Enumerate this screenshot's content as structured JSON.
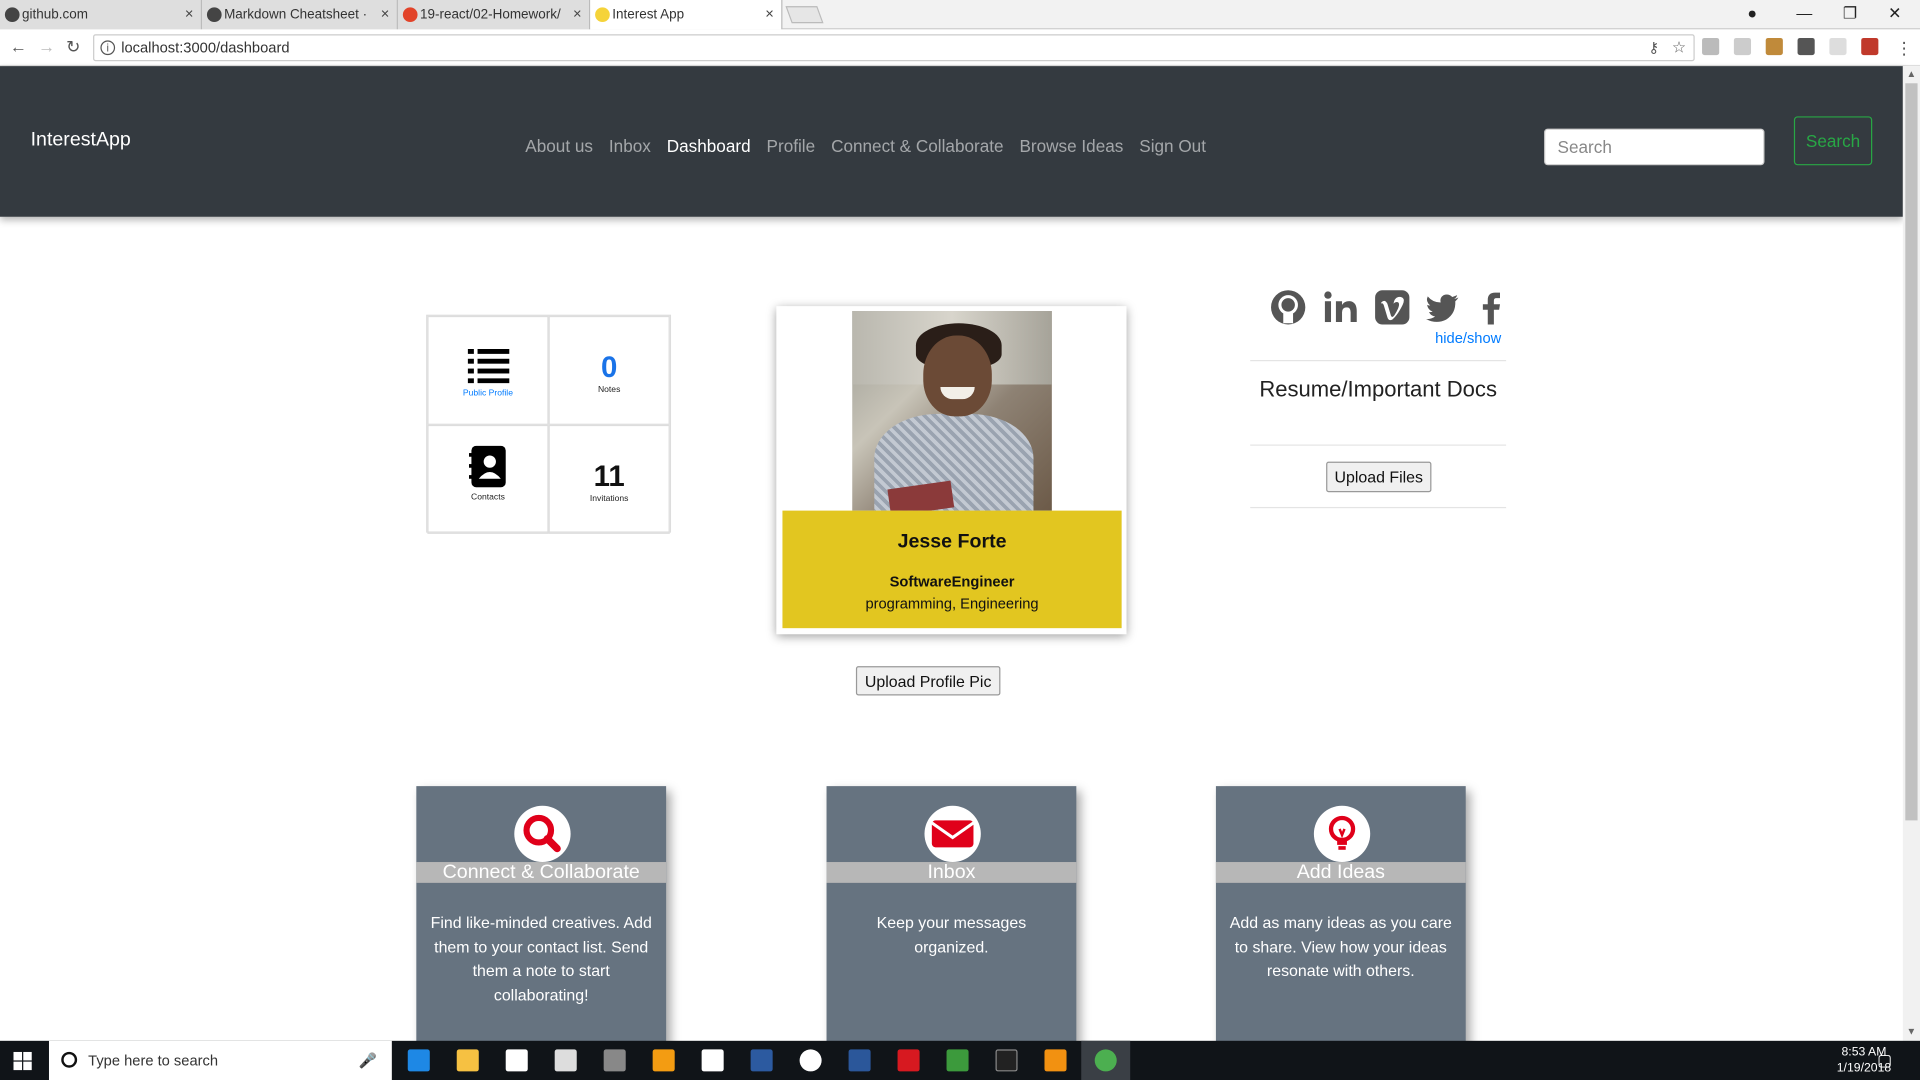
{
  "browser": {
    "tabs": [
      {
        "title": "github.com"
      },
      {
        "title": "Markdown Cheatsheet · "
      },
      {
        "title": "19-react/02-Homework/"
      },
      {
        "title": "Interest App"
      }
    ],
    "url": "localhost:3000/dashboard",
    "info_glyph": "i",
    "close_glyph": "×"
  },
  "navbar": {
    "brand": "InterestApp",
    "links": [
      "About us",
      "Inbox",
      "Dashboard",
      "Profile",
      "Connect & Collaborate",
      "Browse Ideas",
      "Sign Out"
    ],
    "active_link": "Dashboard",
    "search_placeholder": "Search",
    "search_button": "Search",
    "bg_color": "#343a40",
    "search_button_color": "#28a745"
  },
  "stats": {
    "public_profile_label": "Public Profile",
    "notes_count": "0",
    "notes_label": "Notes",
    "contacts_label": "Contacts",
    "invitations_count": "11",
    "invitations_label": "Invitations"
  },
  "profile": {
    "name": "Jesse Forte",
    "title": "SoftwareEngineer",
    "interests": "programming, Engineering",
    "upload_button": "Upload Profile Pic",
    "accent_color": "#e2c620"
  },
  "sidebar": {
    "social_icons": [
      "github-icon",
      "linkedin-icon",
      "vimeo-icon",
      "twitter-icon",
      "facebook-icon"
    ],
    "hide_show": "hide/show",
    "resume_heading": "Resume/Important Docs",
    "upload_files_button": "Upload Files"
  },
  "features": [
    {
      "title": "Connect & Collaborate",
      "icon": "search-icon",
      "description": "Find like-minded creatives. Add them to your contact list. Send them a note to start collaborating!"
    },
    {
      "title": "Inbox",
      "icon": "envelope-icon",
      "description": "Keep your messages organized."
    },
    {
      "title": "Add Ideas",
      "icon": "lightbulb-icon",
      "description": "Add as many ideas as you care to share. View how your ideas resonate with others."
    }
  ],
  "taskbar": {
    "search_placeholder": "Type here to search",
    "time": "8:53 AM",
    "date": "1/19/2018"
  }
}
